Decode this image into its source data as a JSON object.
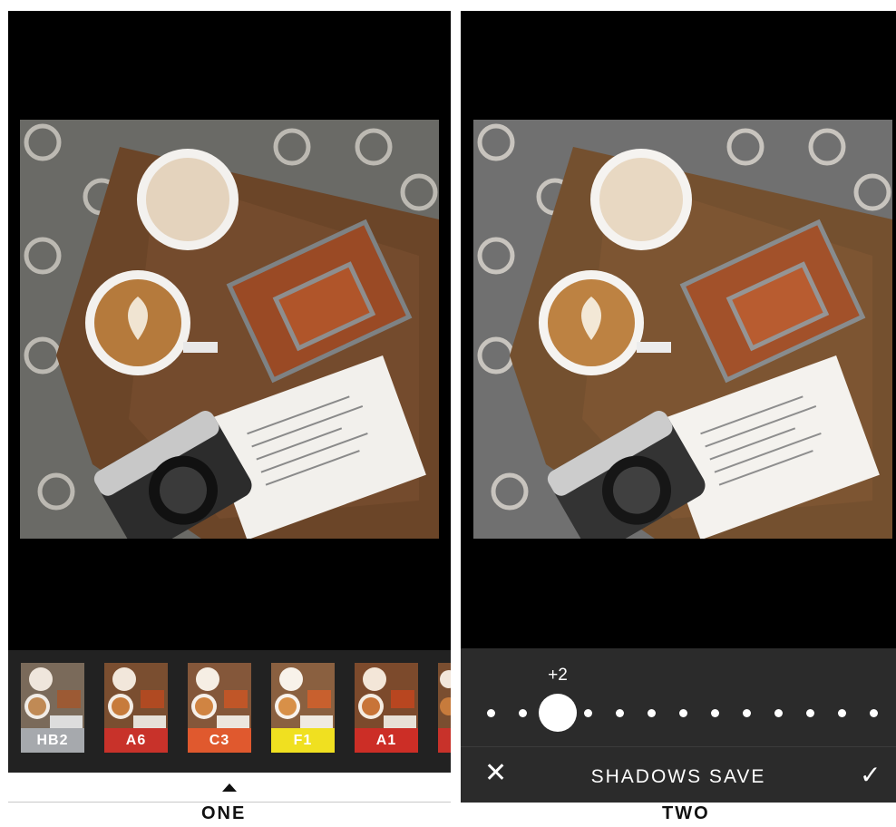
{
  "screen_one": {
    "caption": "ONE",
    "filters": [
      {
        "label": "HB2",
        "color": "#a6a9ad"
      },
      {
        "label": "A6",
        "color": "#c8322a"
      },
      {
        "label": "C3",
        "color": "#e0592e"
      },
      {
        "label": "F1",
        "color": "#f0e020"
      },
      {
        "label": "A1",
        "color": "#cc2e26"
      }
    ],
    "caret_icon": "caret-up-icon"
  },
  "screen_two": {
    "caption": "TWO",
    "slider": {
      "value_label": "+2",
      "level": 2,
      "min": -2,
      "max": 10
    },
    "toolbar": {
      "close_icon": "close-icon",
      "title": "SHADOWS SAVE",
      "confirm_icon": "checkmark-icon"
    }
  },
  "colors": {
    "panel_bg": "#000000",
    "strip_bg": "#222222",
    "tool_bg": "#2b2b2b"
  }
}
